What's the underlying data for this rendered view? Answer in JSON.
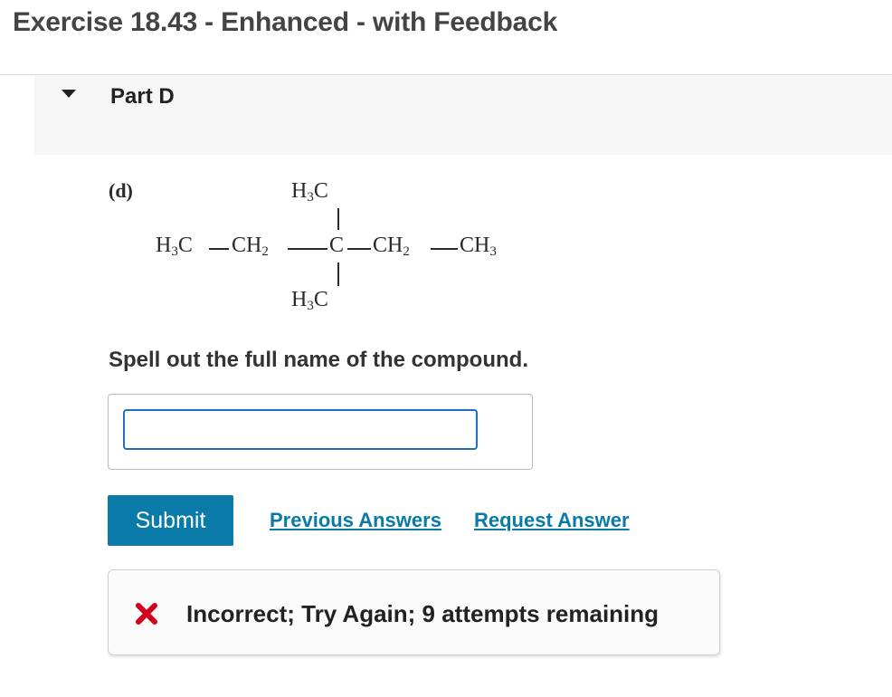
{
  "exercise": {
    "title": "Exercise 18.43 - Enhanced - with Feedback"
  },
  "part": {
    "label": "Part D",
    "toggle_icon": "triangle-down-icon"
  },
  "structure": {
    "label": "(d)",
    "top_substituent": "H₃C",
    "bottom_substituent": "H₃C",
    "chain_start": "H₃C",
    "chain_ch2_left": "CH₂",
    "chain_center": "C",
    "chain_ch2_right": "CH₂",
    "chain_end": "CH₃"
  },
  "question": {
    "prompt": "Spell out the full name of the compound.",
    "answer_value": "",
    "answer_placeholder": ""
  },
  "actions": {
    "submit_label": "Submit",
    "previous_answers_label": "Previous Answers",
    "request_answer_label": "Request Answer"
  },
  "feedback": {
    "icon": "x-icon",
    "message": "Incorrect; Try Again; 9 attempts remaining"
  },
  "colors": {
    "accent": "#0a7aa8",
    "input_focus": "#1e6fc4",
    "error": "#d0021b"
  }
}
